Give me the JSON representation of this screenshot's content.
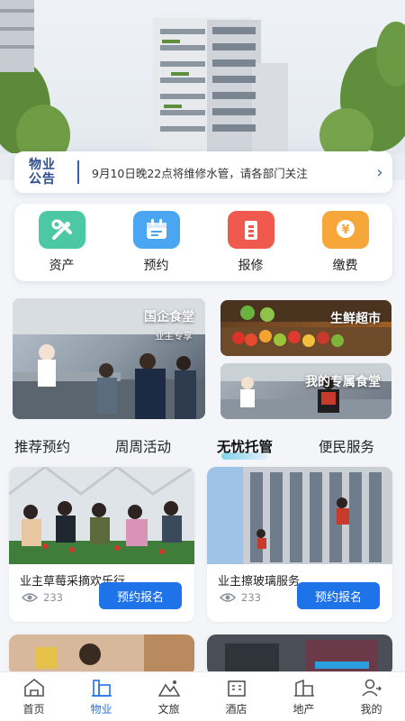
{
  "notice": {
    "logo_line1": "物业",
    "logo_line2": "公告",
    "text": "9月10日晚22点将维修水管，请各部门关注",
    "arrow": "›"
  },
  "quick_actions": [
    {
      "label": "资产",
      "icon": "tools-icon",
      "color": "#4cc9a4"
    },
    {
      "label": "预约",
      "icon": "calendar-icon",
      "color": "#4aa6f0"
    },
    {
      "label": "报修",
      "icon": "building-icon",
      "color": "#f05a4e"
    },
    {
      "label": "缴费",
      "icon": "yen-coin-icon",
      "color": "#f7a63a"
    }
  ],
  "features": {
    "canteen": {
      "title": "国企食堂",
      "subtitle": "业主专享"
    },
    "market": {
      "title": "生鲜超市"
    },
    "my_canteen": {
      "title": "我的专属食堂"
    }
  },
  "tabs": [
    {
      "label": "推荐预约",
      "active": false
    },
    {
      "label": "周周活动",
      "active": false
    },
    {
      "label": "无忧托管",
      "active": true
    },
    {
      "label": "便民服务",
      "active": false
    }
  ],
  "cards": [
    {
      "title": "业主草莓采摘欢乐行",
      "views": "233",
      "button": "预约报名"
    },
    {
      "title": "业主擦玻璃服务",
      "views": "233",
      "button": "预约报名"
    }
  ],
  "bottom_nav": [
    {
      "label": "首页",
      "icon": "home-icon",
      "active": false
    },
    {
      "label": "物业",
      "icon": "property-icon",
      "active": true
    },
    {
      "label": "文旅",
      "icon": "mountain-icon",
      "active": false
    },
    {
      "label": "酒店",
      "icon": "hotel-icon",
      "active": false
    },
    {
      "label": "地产",
      "icon": "real-estate-icon",
      "active": false
    },
    {
      "label": "我的",
      "icon": "user-icon",
      "active": false
    }
  ],
  "colors": {
    "accent": "#1f73e8",
    "notice_blue": "#2e4d8c"
  }
}
